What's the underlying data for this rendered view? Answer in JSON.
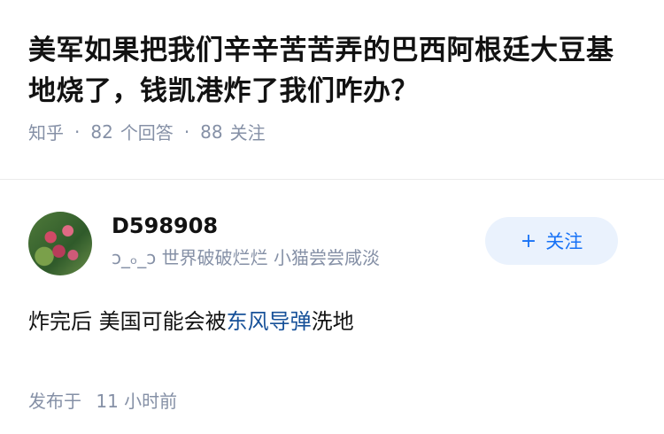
{
  "question": {
    "title": "美军如果把我们辛辛苦苦弄的巴西阿根廷大豆基地烧了，钱凯港炸了我们咋办？",
    "source": "知乎",
    "answers_count": "82",
    "answers_label": "个回答",
    "followers_count": "88",
    "followers_label": "关注"
  },
  "answer": {
    "author": {
      "name": "D598908",
      "headline": "ↄ_ₒ_ↄ 世界破破烂烂 小猫尝尝咸淡",
      "avatar_icon": "flowers-avatar"
    },
    "follow_button": {
      "icon": "plus-icon",
      "symbol": "+",
      "label": "关注",
      "color": "#1772f6",
      "background": "#eaf2fd"
    },
    "content": {
      "text_before": "炸完后 美国可能会被",
      "link_text": "东风导弹",
      "text_after": "洗地"
    },
    "time_label": "发布于",
    "time_value": "11 小时前"
  }
}
